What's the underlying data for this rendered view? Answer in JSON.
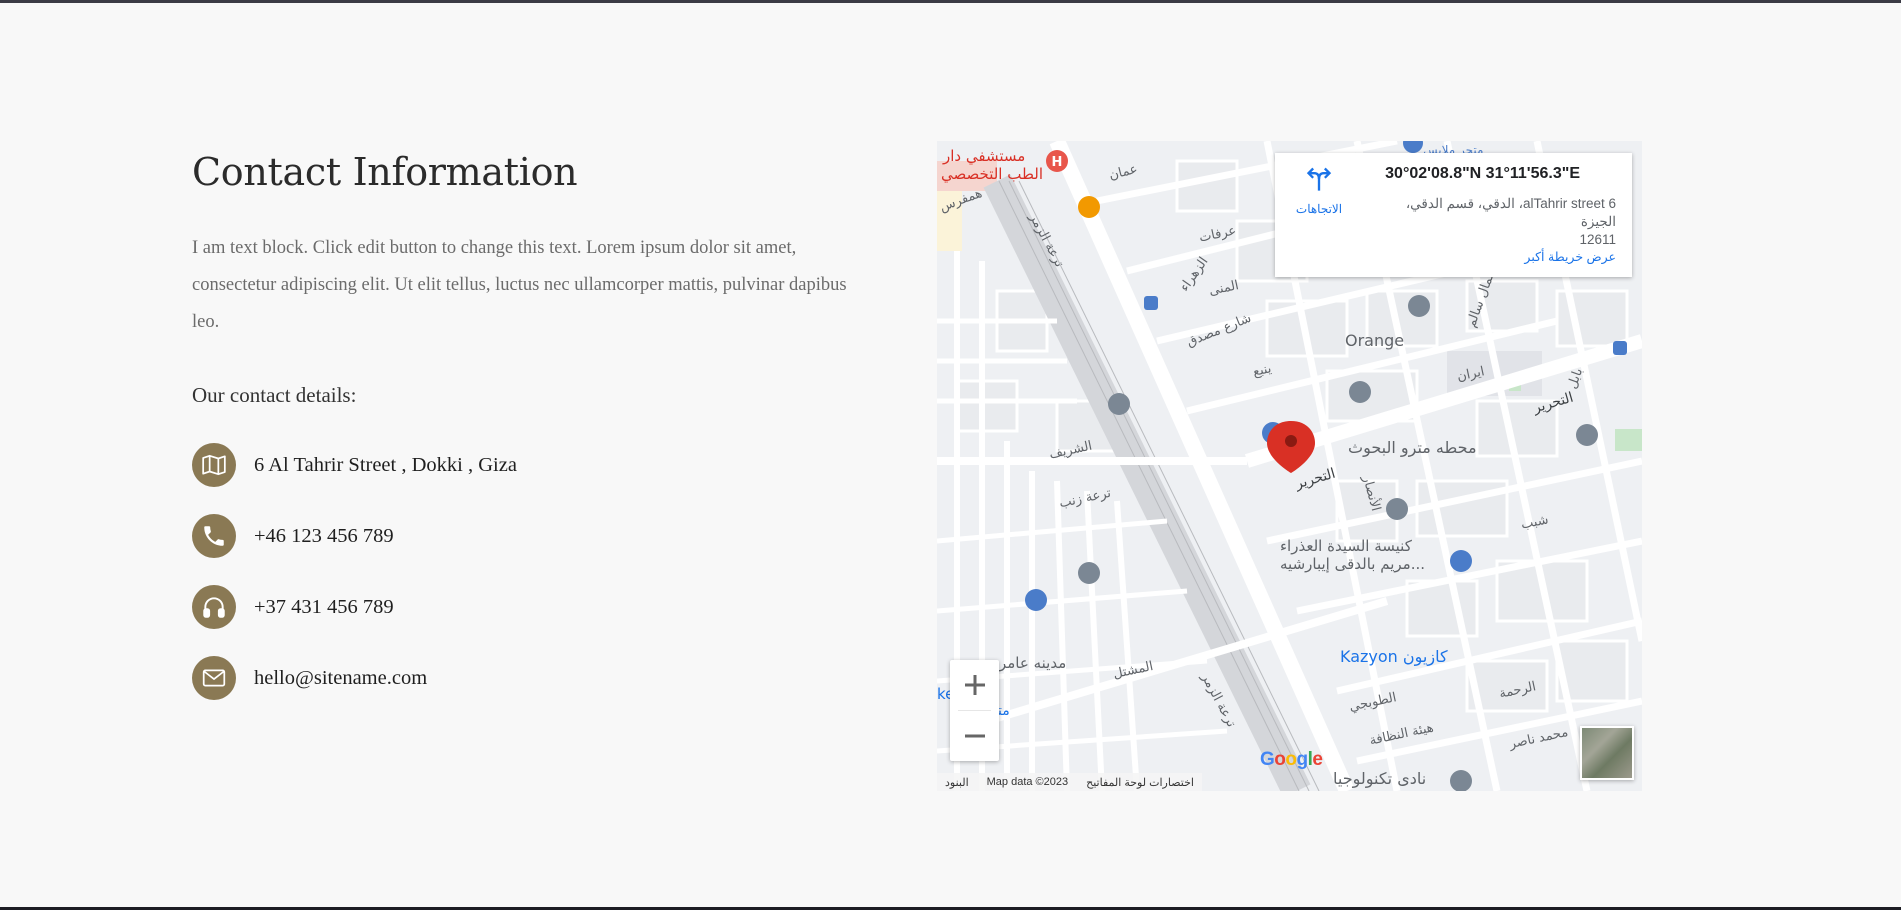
{
  "contact": {
    "title": "Contact Information",
    "lead": "I am text block. Click edit button to change this text. Lorem ipsum dolor sit amet, consectetur adipiscing elit. Ut elit tellus, luctus nec ullamcorper mattis, pulvinar dapibus leo.",
    "details_heading": "Our contact details:",
    "details": [
      {
        "icon": "map-icon",
        "text": "6 Al Tahrir Street , Dokki , Giza"
      },
      {
        "icon": "phone-icon",
        "text": "+46 123 456 789"
      },
      {
        "icon": "headphones-icon",
        "text": "+37 431 456 789"
      },
      {
        "icon": "envelope-icon",
        "text": "hello@sitename.com"
      }
    ],
    "icon_bg": "#8a7954"
  },
  "map": {
    "info_card": {
      "coordinates": "30°02'08.8\"N 31°11'56.3\"E",
      "address_line1": "6 alTahrir street، الدقي، قسم الدقي، الجيزة",
      "address_line2": "12611",
      "directions_label": "الاتجاهات",
      "larger_map_link": "عرض خريطة أكبر"
    },
    "labels": {
      "hospital": "مستشفي دار",
      "hospital2": "الطب التخصصي",
      "amman": "عمان",
      "hamfris": "همفرس",
      "arafat": "عرفات",
      "zahraa": "الزهراء",
      "mona": "المنى",
      "mosadak": "شارع مصدق",
      "yanbo": "ينبع",
      "orange": "Orange",
      "gamal_salem": "جمال سالم",
      "iran": "ايران",
      "babel": "بابل",
      "tahrir_right": "التحرير",
      "metro": "محطه مترو البحوث",
      "tahrir_left": "التحرير",
      "ansar": "الأنصار",
      "sherif": "الشريف",
      "church1": "كنيسة السيدة العذراء",
      "church2": "مريم بالدقى إيبارشيه...",
      "kazyon": "Kazyon كازيون",
      "madina": "مدينه عامر",
      "mashtal": "المشتل",
      "toubgy": "الطوبجي",
      "rahma": "الرحمة",
      "nazafa": "هيئة النظافة",
      "naser": "محمد ناصر",
      "nady": "نادى تكنولوجيا",
      "market": "ket",
      "market2": "متج",
      "zomor": "ترعة الزمر",
      "zomor2": "ترعة الزمر",
      "zeinab": "ترعة زنب",
      "shaheb": "شبب",
      "malabes": "متجر ملابس"
    },
    "zoom_in": "+",
    "zoom_out": "−",
    "google": [
      "G",
      "o",
      "o",
      "g",
      "l",
      "e"
    ],
    "google_colors": [
      "#4285F4",
      "#EA4335",
      "#FBBC05",
      "#4285F4",
      "#34A853",
      "#EA4335"
    ],
    "attribution": {
      "keyboard": "البنود",
      "map_data": "Map data ©2023",
      "shortcuts": "اختصارات لوحة المفاتيح"
    }
  }
}
